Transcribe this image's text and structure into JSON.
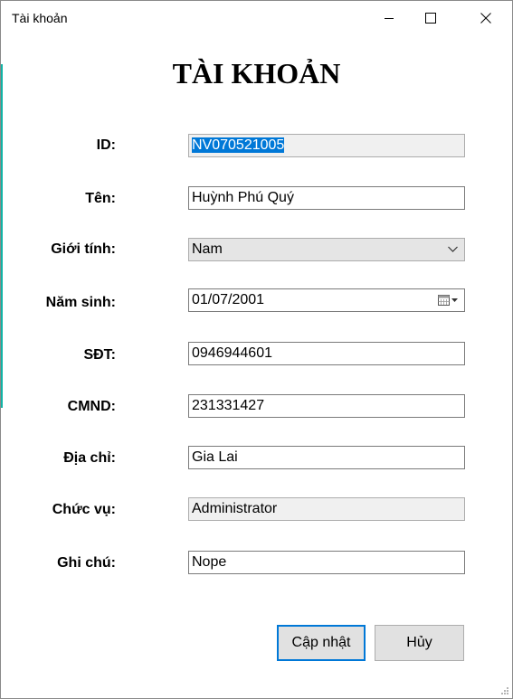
{
  "window": {
    "title": "Tài khoản"
  },
  "heading": "TÀI KHOẢN",
  "fields": {
    "id": {
      "label": "ID:",
      "value": "NV070521005"
    },
    "name": {
      "label": "Tên:",
      "value": "Huỳnh Phú Quý"
    },
    "gender": {
      "label": "Giới tính:",
      "value": "Nam"
    },
    "birth": {
      "label": "Năm sinh:",
      "value": "01/07/2001"
    },
    "phone": {
      "label": "SĐT:",
      "value": "0946944601"
    },
    "idcard": {
      "label": "CMND:",
      "value": "231331427"
    },
    "address": {
      "label": "Địa chỉ:",
      "value": "Gia Lai"
    },
    "position": {
      "label": "Chức vụ:",
      "value": "Administrator"
    },
    "note": {
      "label": "Ghi chú:",
      "value": "Nope"
    }
  },
  "buttons": {
    "update": "Cập nhật",
    "cancel": "Hủy"
  },
  "icons": {
    "minimize": "minimize-icon",
    "maximize": "maximize-icon",
    "close": "close-icon",
    "dropdown": "chevron-down-icon",
    "calendar": "calendar-icon",
    "resize": "resize-grip-icon"
  },
  "colors": {
    "selection": "#0078d7",
    "focus_border": "#0078d7",
    "accent_strip": "#11b3a6"
  }
}
